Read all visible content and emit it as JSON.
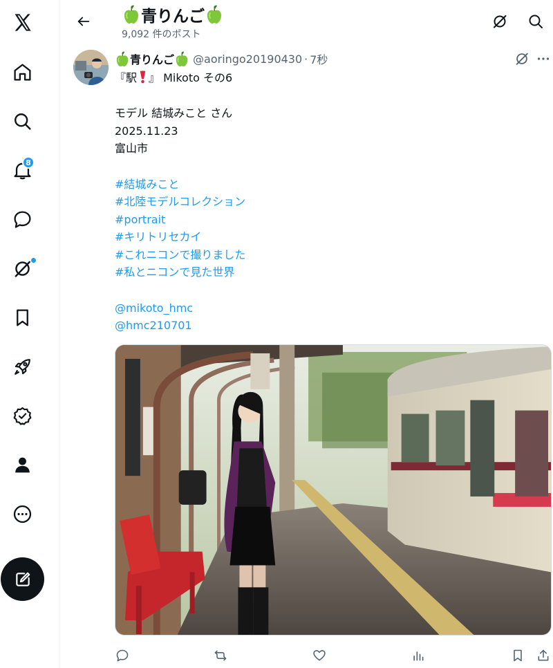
{
  "nav": {
    "notifications_badge": "8",
    "items": [
      "x-logo",
      "home",
      "search",
      "notifications",
      "messages",
      "grok",
      "bookmarks",
      "premium",
      "verified-orgs",
      "profile",
      "more"
    ]
  },
  "header": {
    "title": "青りんご",
    "post_count": "9,092 件のポスト",
    "title_emoji": "green-apple"
  },
  "post": {
    "author_name": "青りんご",
    "handle": "@aoringo20190430",
    "separator": "·",
    "time": "7秒",
    "line1_a": "『駅",
    "line1_b": "』 Mikoto その6",
    "line1_emoji": "red-exclamation",
    "model_line": "モデル 結城みこと さん",
    "date_line": "2025.11.23",
    "place_line": "富山市",
    "hashtags": [
      "#結城みこと",
      "#北陸モデルコレクション",
      "#portrait",
      "#キリトリセカイ",
      "#これニコンで撮りました",
      "#私とニコンで見た世界"
    ],
    "mentions": [
      "@mikoto_hmc",
      "@hmc210701"
    ]
  },
  "colors": {
    "accent": "#1d9bf0",
    "text": "#0f1419",
    "muted": "#536471",
    "border": "#eff3f4"
  }
}
